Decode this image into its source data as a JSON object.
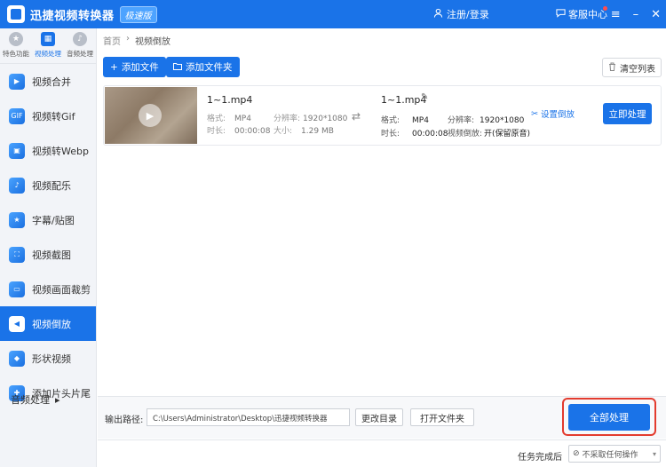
{
  "titlebar": {
    "title": "迅捷视频转换器",
    "badge": "极速版",
    "login": "注册/登录",
    "service": "客服中心",
    "minimize": "–",
    "menu": "≡",
    "close": "✕"
  },
  "sidebar": {
    "categories": [
      {
        "label": "特色功能",
        "icon": "star-icon"
      },
      {
        "label": "视频处理",
        "icon": "film-icon"
      },
      {
        "label": "音频处理",
        "icon": "music-icon"
      }
    ],
    "items": [
      {
        "label": "视频合并"
      },
      {
        "label": "视频转Gif"
      },
      {
        "label": "视频转Webp"
      },
      {
        "label": "视频配乐"
      },
      {
        "label": "字幕/贴图"
      },
      {
        "label": "视频截图"
      },
      {
        "label": "视频画面裁剪"
      },
      {
        "label": "视频倒放"
      },
      {
        "label": "形状视频"
      },
      {
        "label": "添加片头片尾"
      }
    ],
    "audio_link": "音频处理",
    "active_color": "#1a73e8"
  },
  "breadcrumb": {
    "home": "首页",
    "current": "视频倒放"
  },
  "toolbar": {
    "add_file": "添加文件",
    "add_folder": "添加文件夹",
    "clear_list": "清空列表"
  },
  "file": {
    "src_name": "1~1.mp4",
    "src_format_label": "格式:",
    "src_format": "MP4",
    "src_res_label": "分辨率:",
    "src_res": "1920*1080",
    "src_duration_label": "时长:",
    "src_duration": "00:00:08",
    "src_size_label": "大小:",
    "src_size": "1.29 MB",
    "out_name": "1~1.mp4",
    "out_format_label": "格式:",
    "out_format": "MP4",
    "out_res_label": "分辨率:",
    "out_res": "1920*1080",
    "out_duration_label": "时长:",
    "out_duration": "00:00:08",
    "out_reverse_label": "视频倒放:",
    "out_reverse": "开(保留原音)",
    "settings": "设置倒放",
    "process": "立即处理"
  },
  "bottom": {
    "output_label": "输出路径:",
    "output_path": "C:\\Users\\Administrator\\Desktop\\迅捷视频转换器",
    "change_dir": "更改目录",
    "open_folder": "打开文件夹",
    "process_all": "全部处理"
  },
  "status": {
    "after_label": "任务完成后",
    "after_value": "不采取任何操作"
  }
}
